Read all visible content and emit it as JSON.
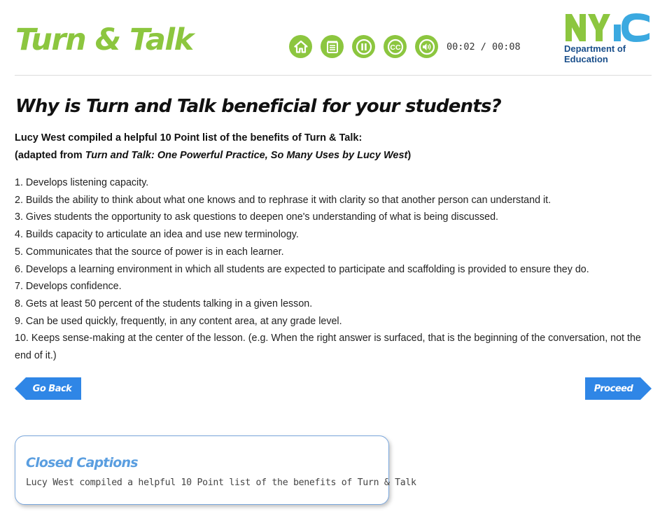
{
  "header": {
    "title": "Turn & Talk",
    "controls": [
      {
        "icon": "home-icon",
        "label": "Home"
      },
      {
        "icon": "menu-icon",
        "label": "Menu"
      },
      {
        "icon": "pause-icon",
        "label": "Pause"
      },
      {
        "icon": "closed-captions-icon",
        "label": "CC"
      },
      {
        "icon": "volume-icon",
        "label": "Volume"
      }
    ],
    "cc_label": "CC",
    "time": "00:02 / 00:08",
    "logo": {
      "mark": "NYC",
      "line1": "Department of",
      "line2": "Education",
      "brand_green": "#8cc63f",
      "brand_blue": "#1a4f8b"
    }
  },
  "content": {
    "heading": "Why is Turn and Talk beneficial for your students?",
    "intro_line1": "Lucy West compiled a helpful 10 Point list of the benefits of Turn & Talk:",
    "intro_line2_pre": "(adapted from ",
    "intro_line2_italic": "Turn and Talk: One Powerful Practice, So Many Uses by Lucy West",
    "intro_line2_post": ")",
    "items": [
      "1. Develops listening capacity.",
      "2. Builds the ability to think about what one knows and to rephrase it with clarity so that another person can understand it.",
      "3. Gives students the opportunity to ask questions to deepen one's understanding of what is being discussed.",
      "4. Builds capacity to articulate an idea and use new terminology.",
      "5. Communicates that the source of power is in each learner.",
      "6. Develops a learning environment in which all students are expected to participate and scaffolding is provided to ensure they do.",
      "7. Develops confidence.",
      "8. Gets at least 50 percent of the students talking in a given lesson.",
      "9. Can be used quickly, frequently, in any content area, at any grade level.",
      "10. Keeps sense-making at the center of the lesson. (e.g. When the right answer is surfaced, that is the beginning of the conversation, not the end of it.)"
    ]
  },
  "nav": {
    "back_label": "Go Back",
    "proceed_label": "Proceed",
    "button_color": "#2f86e6"
  },
  "captions": {
    "title": "Closed Captions",
    "text": "Lucy West compiled a helpful 10 Point list of the benefits of Turn & Talk"
  }
}
